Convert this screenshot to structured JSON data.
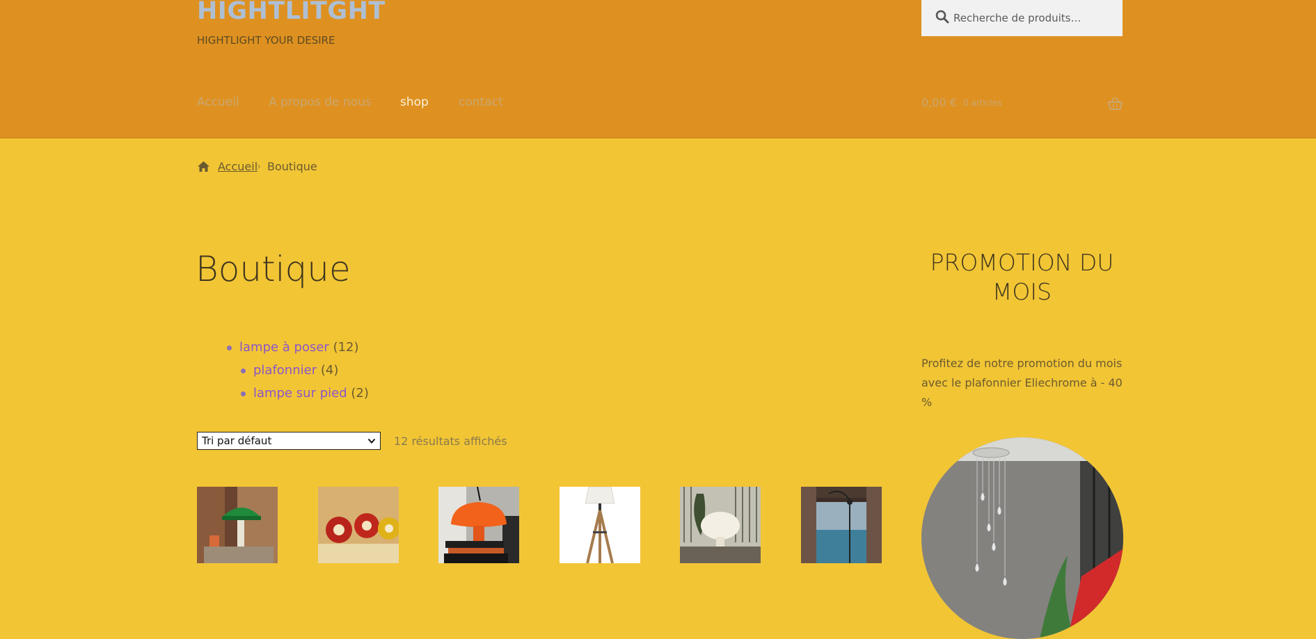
{
  "header": {
    "site_title": "HIGHTLITGHT",
    "site_description": "HIGHTLIGHT YOUR DESIRE",
    "search": {
      "placeholder": "Recherche de produits…",
      "icon": "search-icon"
    },
    "nav": [
      {
        "label": "Accueil",
        "active": false
      },
      {
        "label": "A propos de nous",
        "active": false
      },
      {
        "label": "shop",
        "active": true
      },
      {
        "label": "contact",
        "active": false
      }
    ],
    "cart": {
      "amount": "0,00 €",
      "count": "0 articles",
      "icon": "basket-icon"
    }
  },
  "breadcrumb": {
    "home": "Accueil",
    "separator": "›",
    "current": "Boutique"
  },
  "main": {
    "title": "Boutique",
    "categories": [
      {
        "label": "lampe à poser",
        "count": "(12)",
        "level": 0
      },
      {
        "label": "plafonnier",
        "count": "(4)",
        "level": 1
      },
      {
        "label": "lampe sur pied",
        "count": "(2)",
        "level": 1
      }
    ],
    "sort": {
      "selected": "Tri par défaut"
    },
    "result_count": "12 résultats affichés",
    "products": [
      {
        "name": "green-desk-lamp-image"
      },
      {
        "name": "red-eclisse-lamps-image"
      },
      {
        "name": "orange-nesso-lamp-image"
      },
      {
        "name": "tripod-floor-lamp-image"
      },
      {
        "name": "white-floor-lamp-room-image"
      },
      {
        "name": "arc-lamp-window-image"
      }
    ]
  },
  "sidebar": {
    "title": "PROMOTION DU MOIS",
    "text": "Profitez de notre promotion du mois avec le plafonnier Eliechrome à - 40 %"
  },
  "colors": {
    "header_bg": "#de9121",
    "page_bg": "#f2c535",
    "link_purple": "#8b56c7",
    "title_ghost": "#aebfd3"
  }
}
